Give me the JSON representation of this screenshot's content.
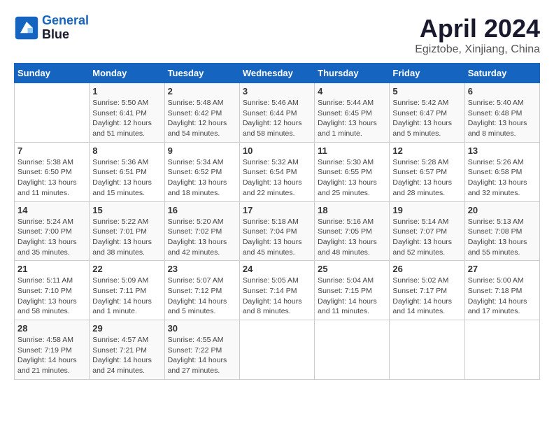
{
  "header": {
    "logo_line1": "General",
    "logo_line2": "Blue",
    "month": "April 2024",
    "location": "Egiztobe, Xinjiang, China"
  },
  "weekdays": [
    "Sunday",
    "Monday",
    "Tuesday",
    "Wednesday",
    "Thursday",
    "Friday",
    "Saturday"
  ],
  "weeks": [
    [
      {
        "day": "",
        "info": ""
      },
      {
        "day": "1",
        "info": "Sunrise: 5:50 AM\nSunset: 6:41 PM\nDaylight: 12 hours\nand 51 minutes."
      },
      {
        "day": "2",
        "info": "Sunrise: 5:48 AM\nSunset: 6:42 PM\nDaylight: 12 hours\nand 54 minutes."
      },
      {
        "day": "3",
        "info": "Sunrise: 5:46 AM\nSunset: 6:44 PM\nDaylight: 12 hours\nand 58 minutes."
      },
      {
        "day": "4",
        "info": "Sunrise: 5:44 AM\nSunset: 6:45 PM\nDaylight: 13 hours\nand 1 minute."
      },
      {
        "day": "5",
        "info": "Sunrise: 5:42 AM\nSunset: 6:47 PM\nDaylight: 13 hours\nand 5 minutes."
      },
      {
        "day": "6",
        "info": "Sunrise: 5:40 AM\nSunset: 6:48 PM\nDaylight: 13 hours\nand 8 minutes."
      }
    ],
    [
      {
        "day": "7",
        "info": "Sunrise: 5:38 AM\nSunset: 6:50 PM\nDaylight: 13 hours\nand 11 minutes."
      },
      {
        "day": "8",
        "info": "Sunrise: 5:36 AM\nSunset: 6:51 PM\nDaylight: 13 hours\nand 15 minutes."
      },
      {
        "day": "9",
        "info": "Sunrise: 5:34 AM\nSunset: 6:52 PM\nDaylight: 13 hours\nand 18 minutes."
      },
      {
        "day": "10",
        "info": "Sunrise: 5:32 AM\nSunset: 6:54 PM\nDaylight: 13 hours\nand 22 minutes."
      },
      {
        "day": "11",
        "info": "Sunrise: 5:30 AM\nSunset: 6:55 PM\nDaylight: 13 hours\nand 25 minutes."
      },
      {
        "day": "12",
        "info": "Sunrise: 5:28 AM\nSunset: 6:57 PM\nDaylight: 13 hours\nand 28 minutes."
      },
      {
        "day": "13",
        "info": "Sunrise: 5:26 AM\nSunset: 6:58 PM\nDaylight: 13 hours\nand 32 minutes."
      }
    ],
    [
      {
        "day": "14",
        "info": "Sunrise: 5:24 AM\nSunset: 7:00 PM\nDaylight: 13 hours\nand 35 minutes."
      },
      {
        "day": "15",
        "info": "Sunrise: 5:22 AM\nSunset: 7:01 PM\nDaylight: 13 hours\nand 38 minutes."
      },
      {
        "day": "16",
        "info": "Sunrise: 5:20 AM\nSunset: 7:02 PM\nDaylight: 13 hours\nand 42 minutes."
      },
      {
        "day": "17",
        "info": "Sunrise: 5:18 AM\nSunset: 7:04 PM\nDaylight: 13 hours\nand 45 minutes."
      },
      {
        "day": "18",
        "info": "Sunrise: 5:16 AM\nSunset: 7:05 PM\nDaylight: 13 hours\nand 48 minutes."
      },
      {
        "day": "19",
        "info": "Sunrise: 5:14 AM\nSunset: 7:07 PM\nDaylight: 13 hours\nand 52 minutes."
      },
      {
        "day": "20",
        "info": "Sunrise: 5:13 AM\nSunset: 7:08 PM\nDaylight: 13 hours\nand 55 minutes."
      }
    ],
    [
      {
        "day": "21",
        "info": "Sunrise: 5:11 AM\nSunset: 7:10 PM\nDaylight: 13 hours\nand 58 minutes."
      },
      {
        "day": "22",
        "info": "Sunrise: 5:09 AM\nSunset: 7:11 PM\nDaylight: 14 hours\nand 1 minute."
      },
      {
        "day": "23",
        "info": "Sunrise: 5:07 AM\nSunset: 7:12 PM\nDaylight: 14 hours\nand 5 minutes."
      },
      {
        "day": "24",
        "info": "Sunrise: 5:05 AM\nSunset: 7:14 PM\nDaylight: 14 hours\nand 8 minutes."
      },
      {
        "day": "25",
        "info": "Sunrise: 5:04 AM\nSunset: 7:15 PM\nDaylight: 14 hours\nand 11 minutes."
      },
      {
        "day": "26",
        "info": "Sunrise: 5:02 AM\nSunset: 7:17 PM\nDaylight: 14 hours\nand 14 minutes."
      },
      {
        "day": "27",
        "info": "Sunrise: 5:00 AM\nSunset: 7:18 PM\nDaylight: 14 hours\nand 17 minutes."
      }
    ],
    [
      {
        "day": "28",
        "info": "Sunrise: 4:58 AM\nSunset: 7:19 PM\nDaylight: 14 hours\nand 21 minutes."
      },
      {
        "day": "29",
        "info": "Sunrise: 4:57 AM\nSunset: 7:21 PM\nDaylight: 14 hours\nand 24 minutes."
      },
      {
        "day": "30",
        "info": "Sunrise: 4:55 AM\nSunset: 7:22 PM\nDaylight: 14 hours\nand 27 minutes."
      },
      {
        "day": "",
        "info": ""
      },
      {
        "day": "",
        "info": ""
      },
      {
        "day": "",
        "info": ""
      },
      {
        "day": "",
        "info": ""
      }
    ]
  ]
}
